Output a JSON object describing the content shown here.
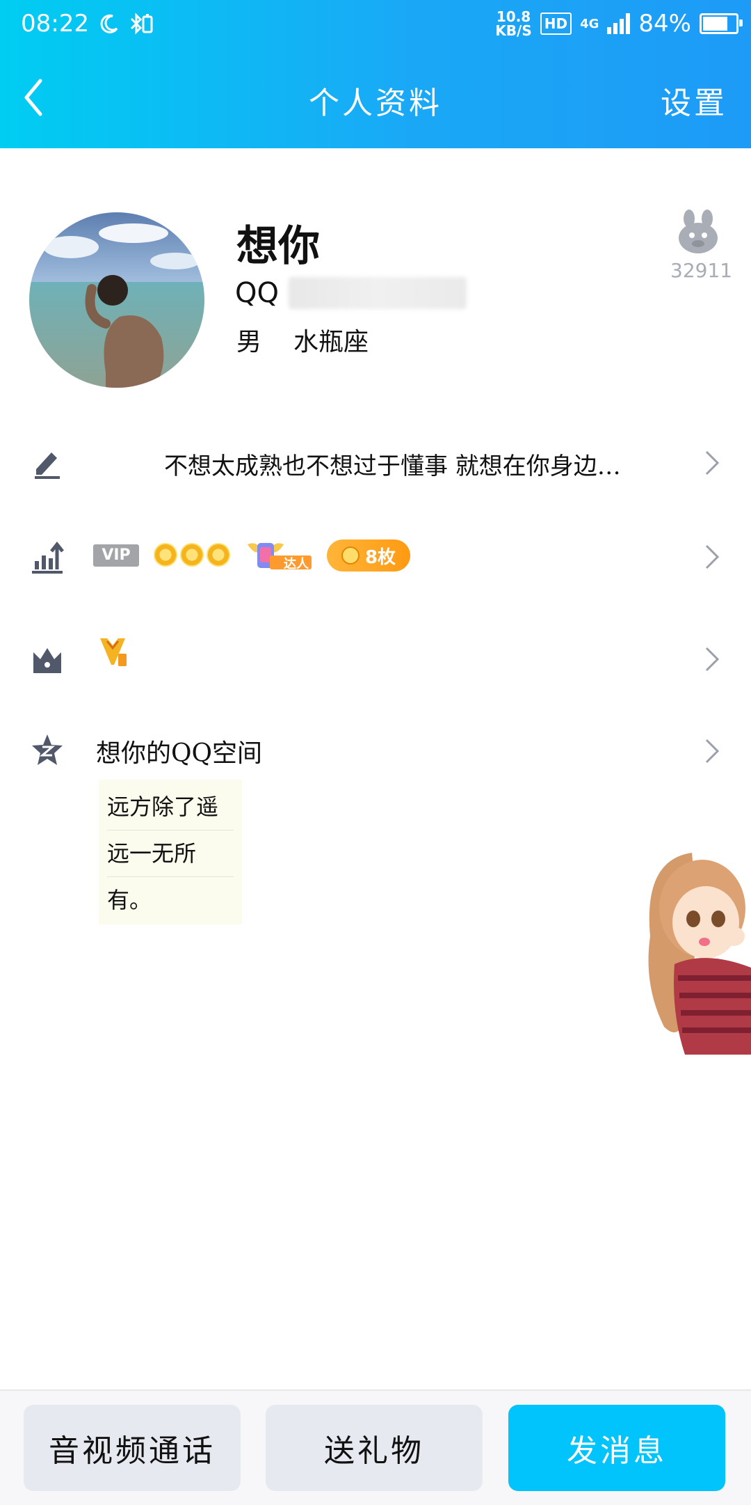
{
  "status_bar": {
    "time": "08:22",
    "net_speed_top": "10.8",
    "net_speed_bottom": "KB/S",
    "hd": "HD",
    "network": "4G",
    "battery": "84%",
    "battery_level": 0.84
  },
  "header": {
    "title": "个人资料",
    "settings": "设置"
  },
  "profile": {
    "name": "想你",
    "qq_label": "QQ",
    "gender": "男",
    "zodiac": "水瓶座",
    "pet_count": "32911"
  },
  "signature": {
    "text": "不想太成熟也不想过于懂事 就想在你身边…"
  },
  "level": {
    "vip": "VIP",
    "talent": "达人",
    "medal_count": "8枚"
  },
  "qzone": {
    "title": "想你的QQ空间",
    "note_lines": [
      "远方除了遥",
      "远一无所",
      "有。"
    ]
  },
  "bottom_bar": {
    "call": "音视频通话",
    "gift": "送礼物",
    "message": "发消息"
  },
  "colors": {
    "accent": "#00c4fb",
    "header_gradient_start": "#00cdf2",
    "header_gradient_end": "#1d9bf7"
  }
}
